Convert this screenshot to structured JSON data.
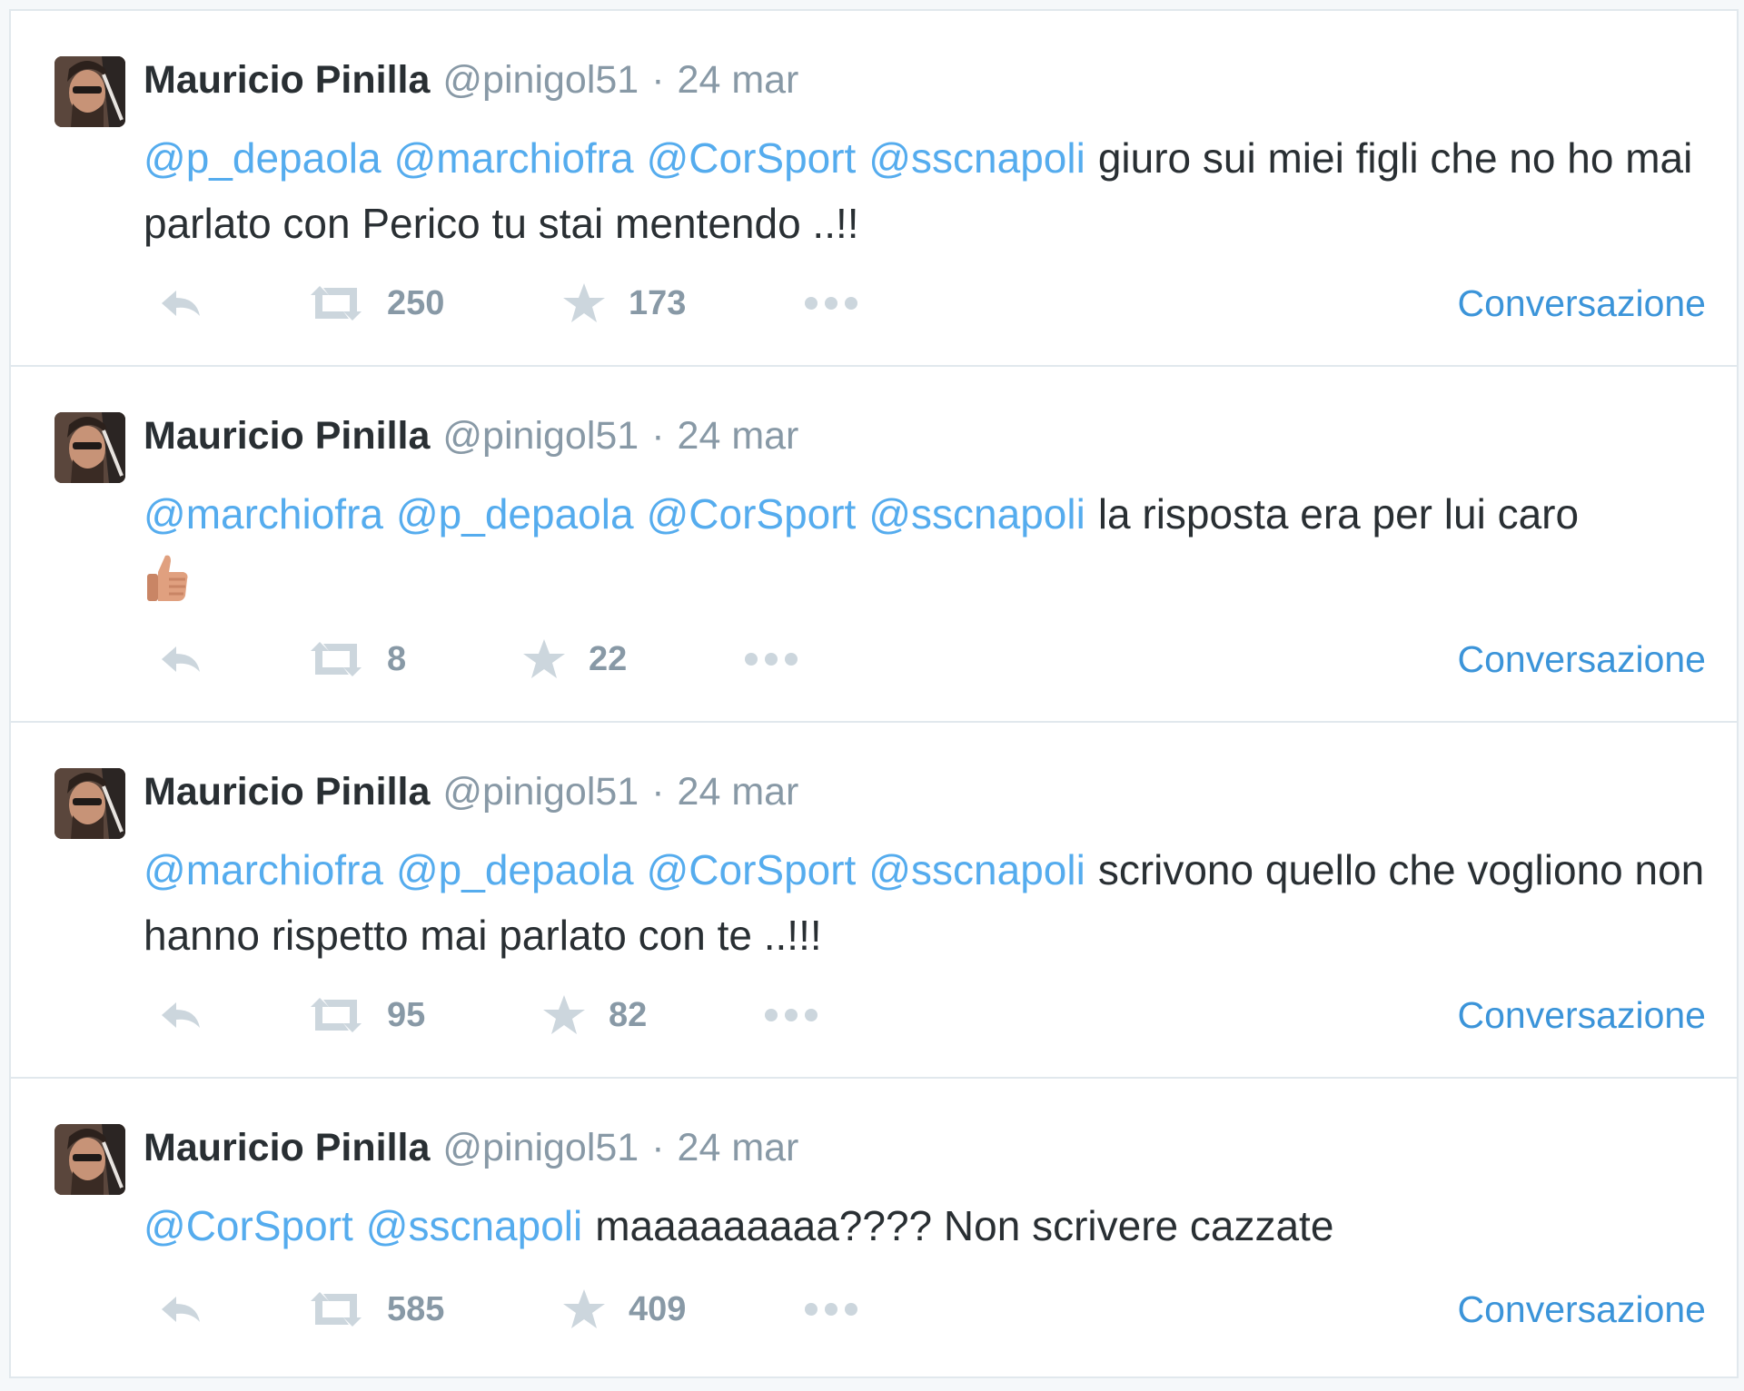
{
  "colors": {
    "link": "#55acee",
    "meta": "#8899a6",
    "text": "#292f33",
    "conversation": "#3b94d9"
  },
  "tweets": [
    {
      "name": "Mauricio Pinilla",
      "handle": "@pinigol51",
      "separator": "·",
      "time": "24 mar",
      "mentions": [
        "@p_depaola",
        "@marchiofra",
        "@CorSport",
        "@sscnapoli"
      ],
      "text": "giuro sui miei figli che no ho mai parlato con Perico tu stai mentendo ..!!",
      "retweets": "250",
      "favorites": "173",
      "conversation": "Conversazione"
    },
    {
      "name": "Mauricio Pinilla",
      "handle": "@pinigol51",
      "separator": "·",
      "time": "24 mar",
      "mentions": [
        "@marchiofra",
        "@p_depaola",
        "@CorSport",
        "@sscnapoli"
      ],
      "text": "la risposta era per lui caro",
      "emoji": "thumbs-up",
      "retweets": "8",
      "favorites": "22",
      "conversation": "Conversazione"
    },
    {
      "name": "Mauricio Pinilla",
      "handle": "@pinigol51",
      "separator": "·",
      "time": "24 mar",
      "mentions": [
        "@marchiofra",
        "@p_depaola",
        "@CorSport",
        "@sscnapoli"
      ],
      "text": "scrivono quello che vogliono non hanno rispetto mai parlato con te ..!!!",
      "retweets": "95",
      "favorites": "82",
      "conversation": "Conversazione"
    },
    {
      "name": "Mauricio Pinilla",
      "handle": "@pinigol51",
      "separator": "·",
      "time": "24 mar",
      "mentions": [
        "@CorSport",
        "@sscnapoli"
      ],
      "text": "maaaaaaaaa???? Non scrivere cazzate",
      "retweets": "585",
      "favorites": "409",
      "conversation": "Conversazione"
    }
  ]
}
